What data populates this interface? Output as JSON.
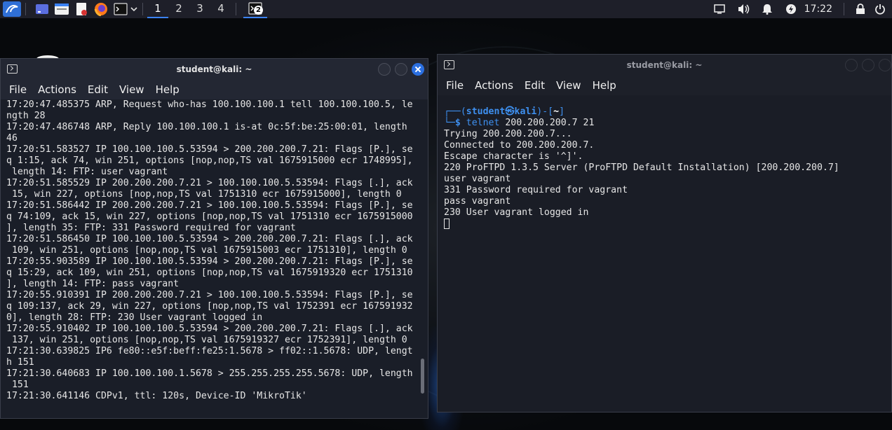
{
  "taskbar": {
    "workspaces": [
      "1",
      "2",
      "3",
      "4"
    ],
    "task_badge": "2",
    "clock": "17:22"
  },
  "left_window": {
    "title": "student@kali: ~",
    "menu": [
      "File",
      "Actions",
      "Edit",
      "View",
      "Help"
    ],
    "lines": [
      "17:20:47.485375 ARP, Request who-has 100.100.100.1 tell 100.100.100.5, le",
      "ngth 28",
      "17:20:47.486748 ARP, Reply 100.100.100.1 is-at 0c:5f:be:25:00:01, length",
      "46",
      "17:20:51.583527 IP 100.100.100.5.53594 > 200.200.200.7.21: Flags [P.], se",
      "q 1:15, ack 74, win 251, options [nop,nop,TS val 1675915000 ecr 1748995],",
      " length 14: FTP: user vagrant",
      "17:20:51.585529 IP 200.200.200.7.21 > 100.100.100.5.53594: Flags [.], ack",
      " 15, win 227, options [nop,nop,TS val 1751310 ecr 1675915000], length 0",
      "17:20:51.586442 IP 200.200.200.7.21 > 100.100.100.5.53594: Flags [P.], se",
      "q 74:109, ack 15, win 227, options [nop,nop,TS val 1751310 ecr 1675915000",
      "], length 35: FTP: 331 Password required for vagrant",
      "17:20:51.586450 IP 100.100.100.5.53594 > 200.200.200.7.21: Flags [.], ack",
      " 109, win 251, options [nop,nop,TS val 1675915003 ecr 1751310], length 0",
      "17:20:55.903589 IP 100.100.100.5.53594 > 200.200.200.7.21: Flags [P.], se",
      "q 15:29, ack 109, win 251, options [nop,nop,TS val 1675919320 ecr 1751310",
      "], length 14: FTP: pass vagrant",
      "17:20:55.910391 IP 200.200.200.7.21 > 100.100.100.5.53594: Flags [P.], se",
      "q 109:137, ack 29, win 227, options [nop,nop,TS val 1752391 ecr 167591932",
      "0], length 28: FTP: 230 User vagrant logged in",
      "17:20:55.910402 IP 100.100.100.5.53594 > 200.200.200.7.21: Flags [.], ack",
      " 137, win 251, options [nop,nop,TS val 1675919327 ecr 1752391], length 0",
      "17:21:30.639825 IP6 fe80::e5f:beff:fe25:1.5678 > ff02::1.5678: UDP, lengt",
      "h 151",
      "17:21:30.640683 IP 100.100.100.1.5678 > 255.255.255.255.5678: UDP, length",
      " 151",
      "17:21:30.641146 CDPv1, ttl: 120s, Device-ID 'MikroTik'"
    ]
  },
  "right_window": {
    "title": "student@kali: ~",
    "menu": [
      "File",
      "Actions",
      "Edit",
      "View",
      "Help"
    ],
    "prompt": {
      "open": "┌──(",
      "user": "student",
      "at": "㉿",
      "host": "kali",
      "mid": ")-[",
      "dir": "~",
      "close": "]",
      "arrow": "└─$ ",
      "command": "telnet",
      "args": " 200.200.200.7 21"
    },
    "output": [
      "Trying 200.200.200.7...",
      "Connected to 200.200.200.7.",
      "Escape character is '^]'.",
      "220 ProFTPD 1.3.5 Server (ProFTPD Default Installation) [200.200.200.7]",
      "user vagrant",
      "331 Password required for vagrant",
      "pass vagrant",
      "230 User vagrant logged in"
    ]
  }
}
